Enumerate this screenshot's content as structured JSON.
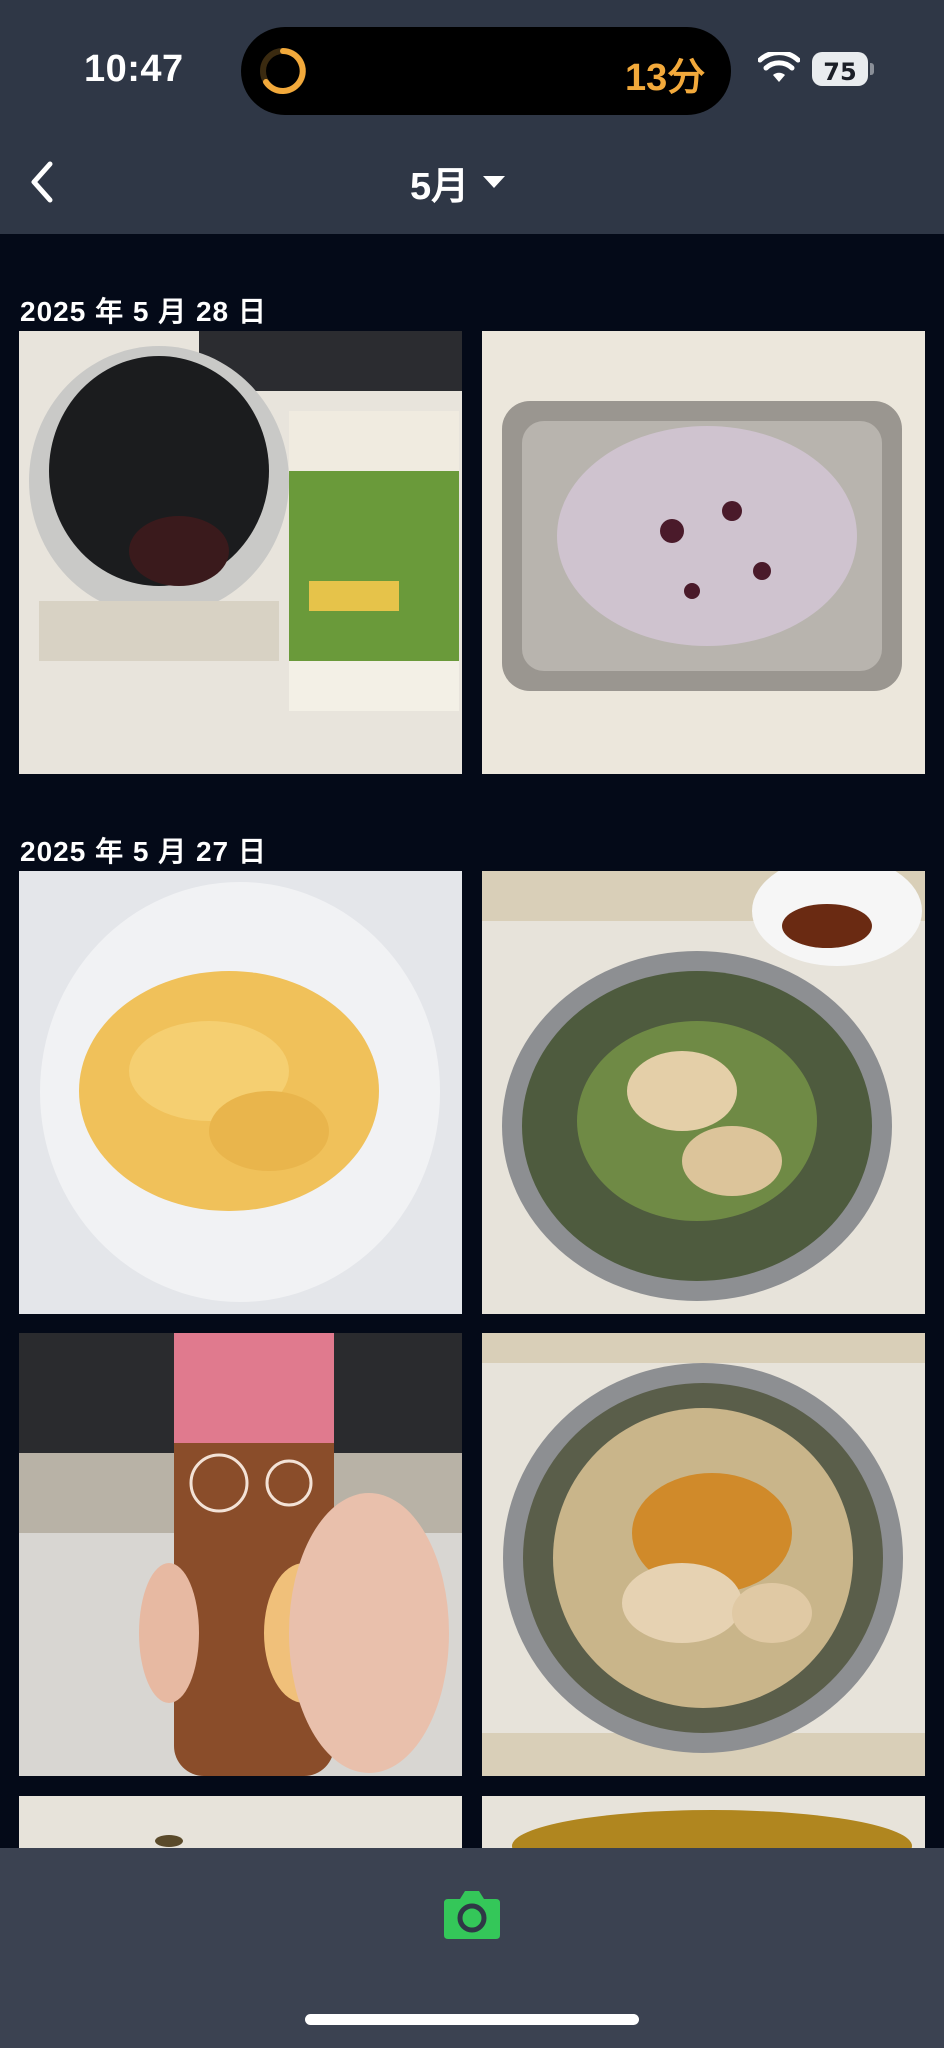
{
  "status_bar": {
    "time": "10:47",
    "timer_text": "13分",
    "battery_level": "75"
  },
  "header": {
    "month": "5月"
  },
  "sections": [
    {
      "date": "2025 年 5 月 28 日",
      "photo_count": 2
    },
    {
      "date": "2025 年 5 月 27 日",
      "photo_count": 4
    }
  ],
  "icons": {
    "back": "chevron-left-icon",
    "camera": "camera-icon",
    "wifi": "wifi-icon",
    "timer": "timer-ring-icon"
  },
  "colors": {
    "header_bg": "#2f3746",
    "content_bg": "#040a18",
    "timer_accent": "#f2a93b",
    "camera_green": "#34c759"
  }
}
